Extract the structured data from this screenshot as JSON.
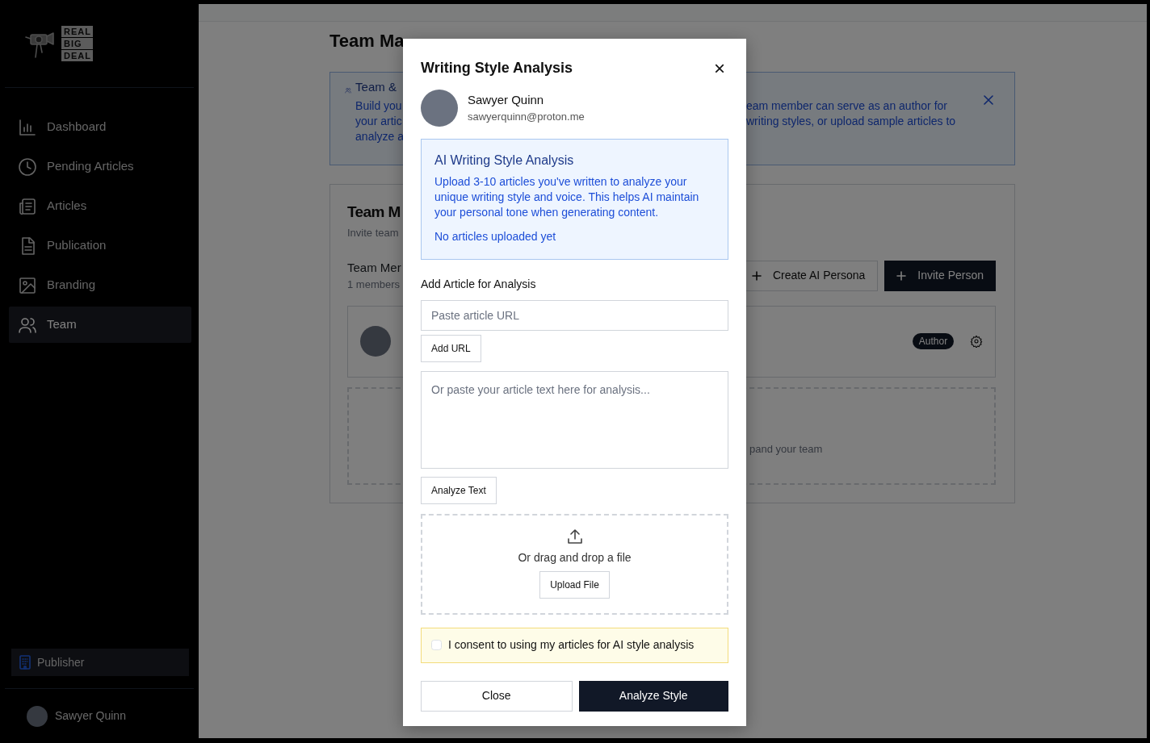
{
  "logo": {
    "lines": [
      "REAL",
      "BIG",
      "DEAL"
    ]
  },
  "sidebar": {
    "items": [
      {
        "label": "Dashboard",
        "kind": "chart",
        "selected": false
      },
      {
        "label": "Pending Articles",
        "kind": "clock",
        "selected": false
      },
      {
        "label": "Articles",
        "kind": "newspaper",
        "selected": false
      },
      {
        "label": "Publication",
        "kind": "document",
        "selected": false
      },
      {
        "label": "Branding",
        "kind": "image",
        "selected": false
      },
      {
        "label": "Team",
        "kind": "people",
        "selected": true
      }
    ],
    "publisher": {
      "label": "Publisher"
    },
    "user": {
      "name": "Sawyer Quinn"
    }
  },
  "page": {
    "title": "Team Ma",
    "alert": {
      "title": "Team &",
      "left_lines": [
        "Build you",
        "your artic",
        "analyze a"
      ],
      "right_lines": [
        "eam member can serve as an author for",
        "writing styles, or upload sample articles to"
      ]
    },
    "card": {
      "title": "Team M",
      "subtitle": "Invite team",
      "section_title": "Team Mer",
      "member_count": "1 members",
      "buttons": [
        {
          "label": "Create AI Persona",
          "kind": "outline"
        },
        {
          "label": "Invite Person",
          "kind": "primary"
        }
      ],
      "member": {
        "badge": "Author"
      },
      "empty_hint": "pand your team"
    }
  },
  "modal": {
    "title": "Writing Style Analysis",
    "close": "×",
    "person": {
      "name": "Sawyer Quinn",
      "email": "sawyerquinn@proton.me"
    },
    "info": {
      "title": "AI Writing Style Analysis",
      "text": "Upload 3-10 articles you've written to analyze your unique writing style and voice. This helps AI maintain your personal tone when generating content.",
      "status": "No articles uploaded yet"
    },
    "section_label": "Add Article for Analysis",
    "url_field": {
      "placeholder": "Paste article URL"
    },
    "add_url": "Add URL",
    "text_field": {
      "placeholder": "Or paste your article text here for analysis..."
    },
    "analyze_text": "Analyze Text",
    "dropzone": {
      "text": "Or drag and drop a file",
      "button": "Upload File"
    },
    "consent": {
      "label": "I consent to using my articles for AI style analysis",
      "checked": false
    },
    "buttons": [
      {
        "label": "Close",
        "kind": "secondary"
      },
      {
        "label": "Analyze Style",
        "kind": "primary"
      }
    ]
  }
}
